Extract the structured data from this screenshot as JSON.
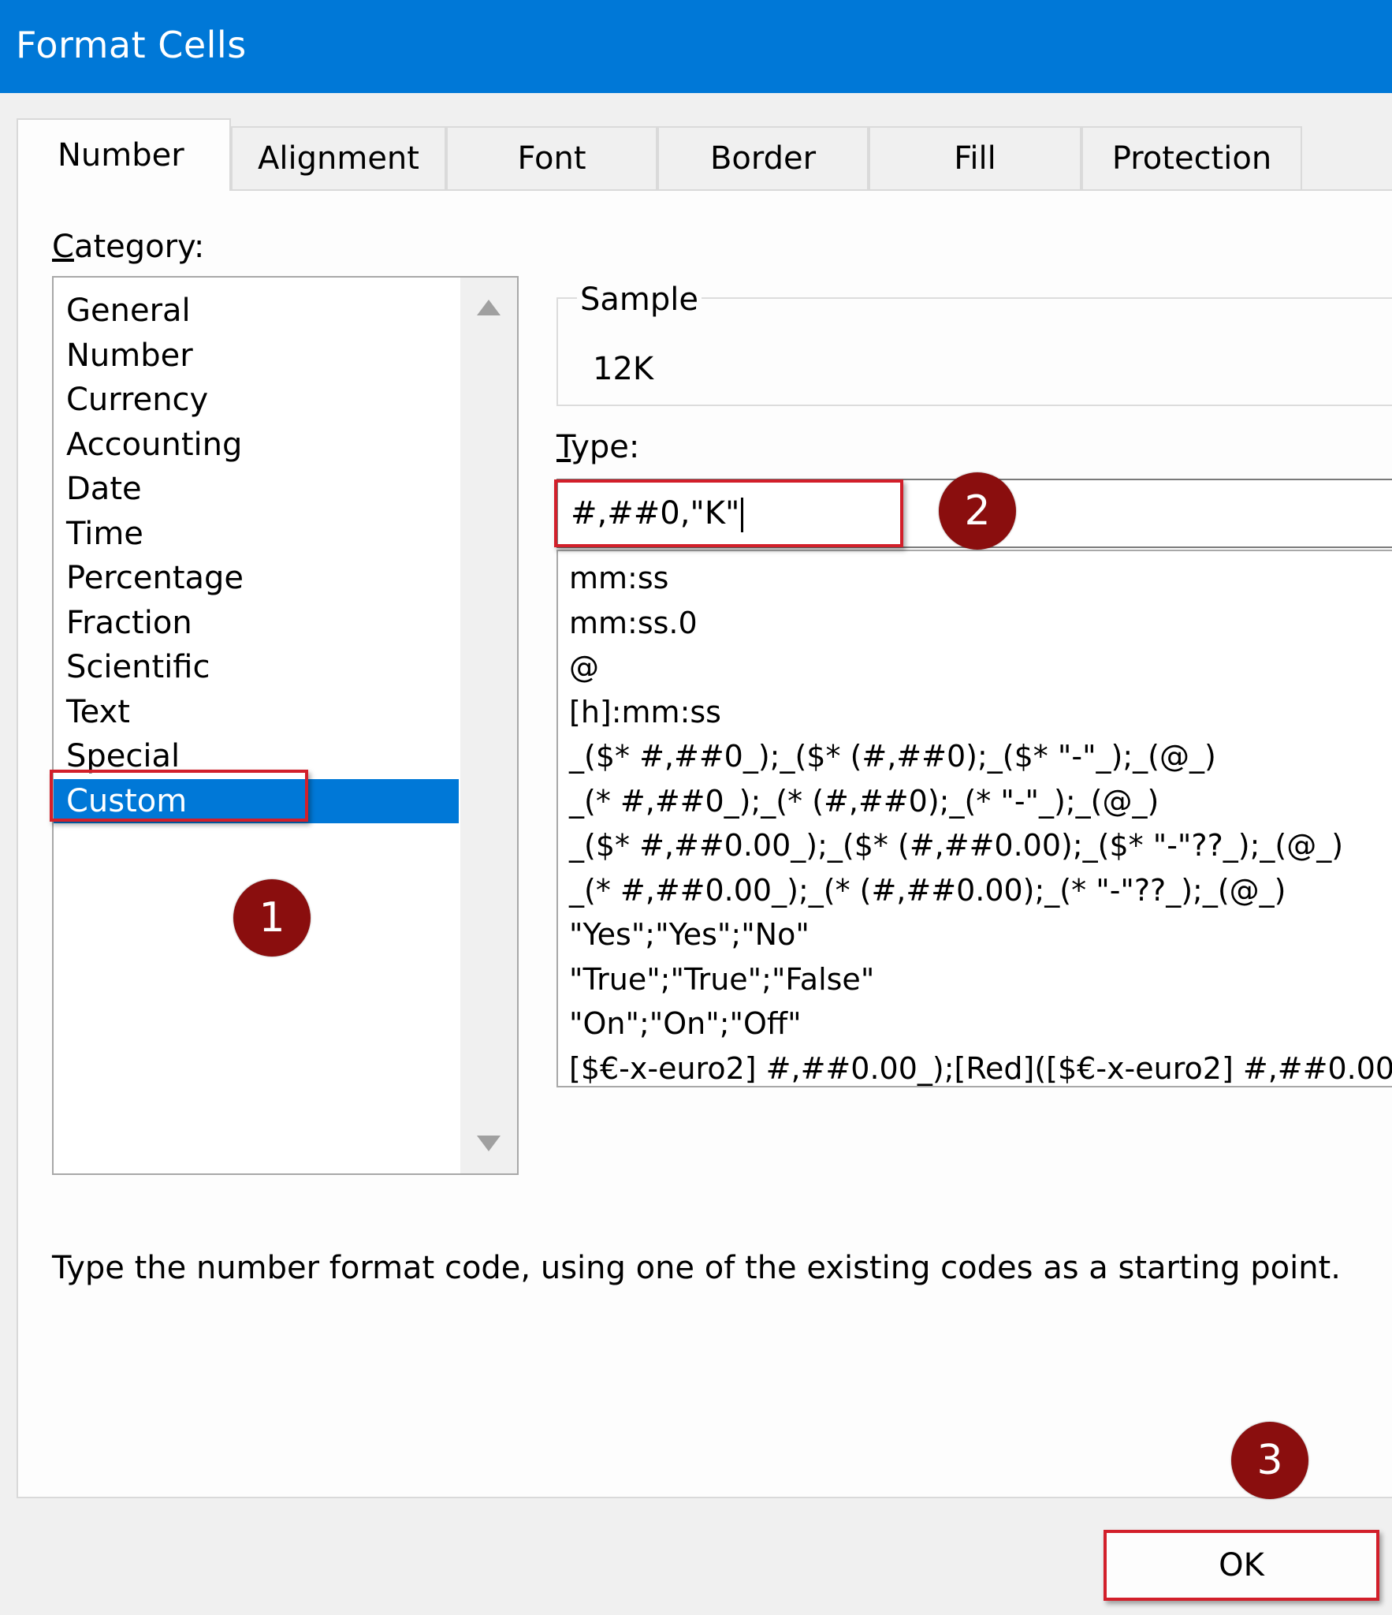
{
  "window": {
    "title": "Format Cells"
  },
  "tabs": [
    {
      "label": "Number",
      "active": true
    },
    {
      "label": "Alignment"
    },
    {
      "label": "Font"
    },
    {
      "label": "Border"
    },
    {
      "label": "Fill"
    },
    {
      "label": "Protection"
    }
  ],
  "category": {
    "label_key": "C",
    "label_rest": "ategory:",
    "items": [
      "General",
      "Number",
      "Currency",
      "Accounting",
      "Date",
      "Time",
      "Percentage",
      "Fraction",
      "Scientific",
      "Text",
      "Special",
      "Custom"
    ],
    "selected": "Custom"
  },
  "sample": {
    "legend": "Sample",
    "value": "12K"
  },
  "type": {
    "label_key": "T",
    "label_rest": "ype:",
    "value": "#,##0,\"K\"",
    "list": [
      "mm:ss",
      "mm:ss.0",
      "@",
      "[h]:mm:ss",
      "_($* #,##0_);_($* (#,##0);_($* \"-\"_);_(@_)",
      "_(* #,##0_);_(* (#,##0);_(* \"-\"_);_(@_)",
      "_($* #,##0.00_);_($* (#,##0.00);_($* \"-\"??_);_(@_)",
      "_(* #,##0.00_);_(* (#,##0.00);_(* \"-\"??_);_(@_)",
      "\"Yes\";\"Yes\";\"No\"",
      "\"True\";\"True\";\"False\"",
      "\"On\";\"On\";\"Off\"",
      "[$€-x-euro2] #,##0.00_);[Red]([$€-x-euro2] #,##0.00)"
    ]
  },
  "hint": "Type the number format code, using one of the existing codes as a starting point.",
  "buttons": {
    "ok": "OK"
  },
  "markers": [
    "1",
    "2",
    "3"
  ],
  "colors": {
    "accent": "#0078d7",
    "highlight": "#d21f2a",
    "marker": "#8a0e0e"
  }
}
